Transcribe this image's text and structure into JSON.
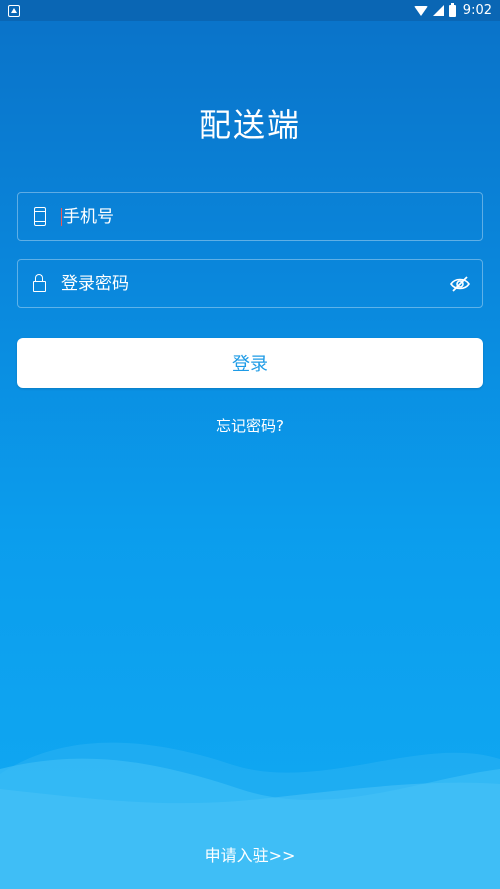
{
  "status_bar": {
    "time": "9:02"
  },
  "app": {
    "title": "配送端"
  },
  "form": {
    "phone_placeholder": "手机号",
    "password_placeholder": "登录密码",
    "login_label": "登录",
    "forgot_label": "忘记密码?"
  },
  "footer": {
    "apply_label": "申请入驻>>"
  },
  "colors": {
    "accent": "#1e9be6",
    "bg_top": "#0a72c8",
    "bg_bottom": "#11aaf3"
  },
  "icons": [
    "notification-icon",
    "wifi-icon",
    "signal-icon",
    "battery-icon",
    "phone-icon",
    "lock-icon",
    "eye-off-icon"
  ]
}
